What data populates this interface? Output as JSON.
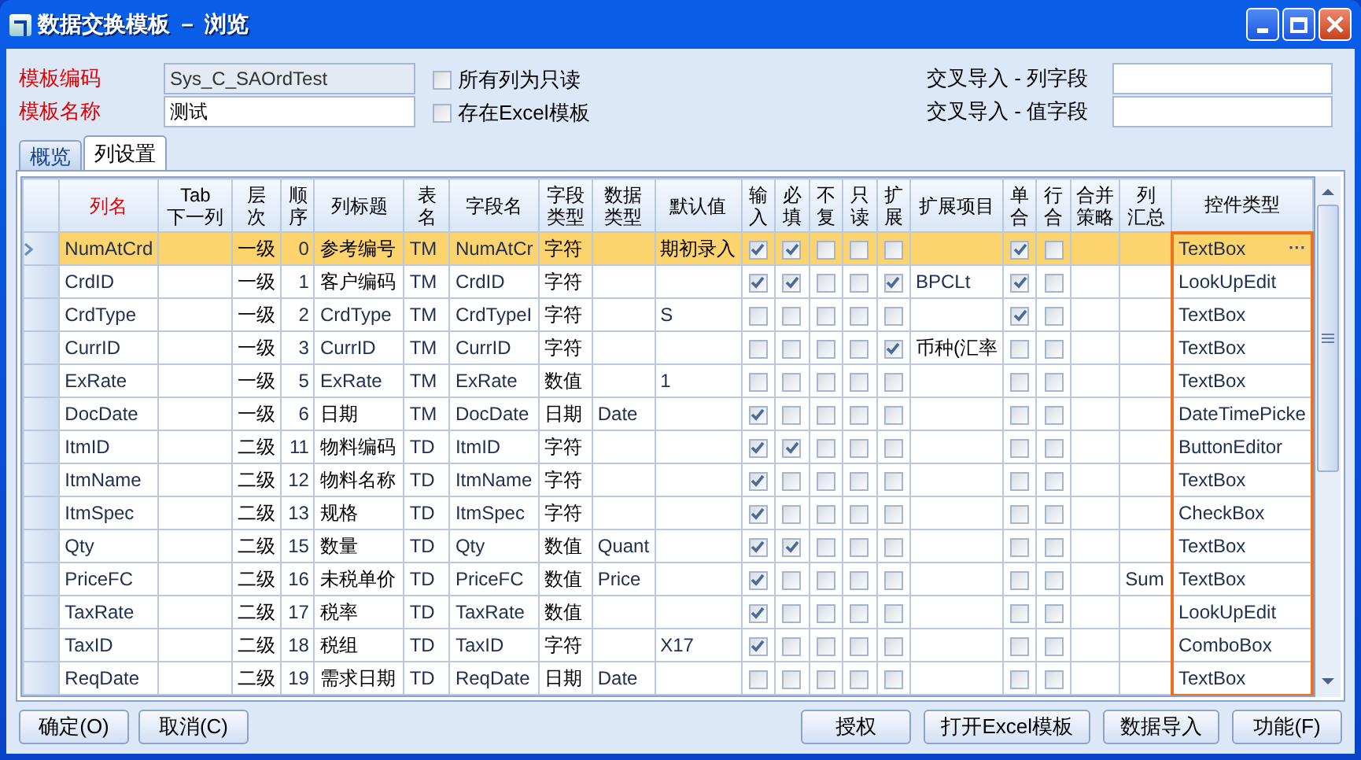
{
  "window": {
    "title": "数据交换模板 － 浏览"
  },
  "form": {
    "fields": [
      {
        "label": "模板编码",
        "value": "Sys_C_SAOrdTest",
        "disabled": true
      },
      {
        "label": "模板名称",
        "value": "测试",
        "disabled": false
      }
    ],
    "checkboxes": [
      {
        "label": "所有列为只读",
        "checked": false
      },
      {
        "label": "存在Excel模板",
        "checked": false
      }
    ],
    "cross_fields": [
      {
        "label": "交叉导入 - 列字段"
      },
      {
        "label": "交叉导入 - 值字段"
      }
    ]
  },
  "tabs": [
    {
      "label": "概览",
      "selected": false
    },
    {
      "label": "列设置",
      "selected": true
    }
  ],
  "table": {
    "columns": [
      {
        "lines": [
          "列名"
        ],
        "kind": "text",
        "emphasis": true,
        "focused": false
      },
      {
        "lines": [
          "Tab",
          "下一列"
        ],
        "kind": "text",
        "emphasis": false,
        "focused": false
      },
      {
        "lines": [
          "层",
          "次"
        ],
        "kind": "text",
        "emphasis": false,
        "focused": false
      },
      {
        "lines": [
          "顺",
          "序"
        ],
        "kind": "number",
        "emphasis": false,
        "focused": false
      },
      {
        "lines": [
          "列标题"
        ],
        "kind": "text",
        "emphasis": false,
        "focused": false
      },
      {
        "lines": [
          "表",
          "名"
        ],
        "kind": "text",
        "emphasis": false,
        "focused": false
      },
      {
        "lines": [
          "字段名"
        ],
        "kind": "text",
        "emphasis": false,
        "focused": false
      },
      {
        "lines": [
          "字段",
          "类型"
        ],
        "kind": "text",
        "emphasis": false,
        "focused": false
      },
      {
        "lines": [
          "数据",
          "类型"
        ],
        "kind": "text",
        "emphasis": false,
        "focused": false
      },
      {
        "lines": [
          "默认值"
        ],
        "kind": "text",
        "emphasis": false,
        "focused": false
      },
      {
        "lines": [
          "输",
          "入"
        ],
        "kind": "check",
        "emphasis": false,
        "focused": false
      },
      {
        "lines": [
          "必",
          "填"
        ],
        "kind": "check",
        "emphasis": false,
        "focused": false
      },
      {
        "lines": [
          "不",
          "复"
        ],
        "kind": "check",
        "emphasis": false,
        "focused": false
      },
      {
        "lines": [
          "只",
          "读"
        ],
        "kind": "check",
        "emphasis": false,
        "focused": false
      },
      {
        "lines": [
          "扩",
          "展"
        ],
        "kind": "check",
        "emphasis": false,
        "focused": false
      },
      {
        "lines": [
          "扩展项目"
        ],
        "kind": "text",
        "emphasis": false,
        "focused": false
      },
      {
        "lines": [
          "单",
          "合"
        ],
        "kind": "check",
        "emphasis": false,
        "focused": false
      },
      {
        "lines": [
          "行",
          "合"
        ],
        "kind": "check",
        "emphasis": false,
        "focused": false
      },
      {
        "lines": [
          "合并",
          "策略"
        ],
        "kind": "text",
        "emphasis": false,
        "focused": false
      },
      {
        "lines": [
          "列",
          "汇总"
        ],
        "kind": "text",
        "emphasis": false,
        "focused": false
      },
      {
        "lines": [
          "控件类型"
        ],
        "kind": "text",
        "emphasis": false,
        "focused": true
      }
    ],
    "rows": [
      {
        "selected": true,
        "cells": [
          "NumAtCrd",
          null,
          "一级",
          "0",
          "参考编号",
          "TM",
          "NumAtCr",
          "字符",
          null,
          "期初录入",
          true,
          true,
          false,
          false,
          false,
          null,
          true,
          false,
          null,
          null,
          "TextBox"
        ],
        "button": "···"
      },
      {
        "selected": false,
        "cells": [
          "CrdID",
          null,
          "一级",
          "1",
          "客户编码",
          "TM",
          "CrdID",
          "字符",
          null,
          null,
          true,
          true,
          false,
          false,
          true,
          "BPCLt",
          true,
          false,
          null,
          null,
          "LookUpEdit"
        ]
      },
      {
        "selected": false,
        "cells": [
          "CrdType",
          null,
          "一级",
          "2",
          "CrdType",
          "TM",
          "CrdTypeI",
          "字符",
          null,
          "S",
          false,
          false,
          false,
          false,
          false,
          null,
          true,
          false,
          null,
          null,
          "TextBox"
        ]
      },
      {
        "selected": false,
        "cells": [
          "CurrID",
          null,
          "一级",
          "3",
          "CurrID",
          "TM",
          "CurrID",
          "字符",
          null,
          null,
          false,
          false,
          false,
          false,
          true,
          "币种(汇率",
          false,
          false,
          null,
          null,
          "TextBox"
        ]
      },
      {
        "selected": false,
        "cells": [
          "ExRate",
          null,
          "一级",
          "5",
          "ExRate",
          "TM",
          "ExRate",
          "数值",
          null,
          "1",
          false,
          false,
          false,
          false,
          false,
          null,
          false,
          false,
          null,
          null,
          "TextBox"
        ]
      },
      {
        "selected": false,
        "cells": [
          "DocDate",
          null,
          "一级",
          "6",
          "日期",
          "TM",
          "DocDate",
          "日期",
          "Date",
          null,
          true,
          false,
          false,
          false,
          false,
          null,
          false,
          false,
          null,
          null,
          "DateTimePicke"
        ]
      },
      {
        "selected": false,
        "cells": [
          "ItmID",
          null,
          "二级",
          "11",
          "物料编码",
          "TD",
          "ItmID",
          "字符",
          null,
          null,
          true,
          true,
          false,
          false,
          false,
          null,
          false,
          false,
          null,
          null,
          "ButtonEditor"
        ]
      },
      {
        "selected": false,
        "cells": [
          "ItmName",
          null,
          "二级",
          "12",
          "物料名称",
          "TD",
          "ItmName",
          "字符",
          null,
          null,
          true,
          false,
          false,
          false,
          false,
          null,
          false,
          false,
          null,
          null,
          "TextBox"
        ]
      },
      {
        "selected": false,
        "cells": [
          "ItmSpec",
          null,
          "二级",
          "13",
          "规格",
          "TD",
          "ItmSpec",
          "字符",
          null,
          null,
          true,
          false,
          false,
          false,
          false,
          null,
          false,
          false,
          null,
          null,
          "CheckBox"
        ]
      },
      {
        "selected": false,
        "cells": [
          "Qty",
          null,
          "二级",
          "15",
          "数量",
          "TD",
          "Qty",
          "数值",
          "Quant",
          null,
          true,
          true,
          false,
          false,
          false,
          null,
          false,
          false,
          null,
          null,
          "TextBox"
        ]
      },
      {
        "selected": false,
        "cells": [
          "PriceFC",
          null,
          "二级",
          "16",
          "未税单价",
          "TD",
          "PriceFC",
          "数值",
          "Price",
          null,
          true,
          false,
          false,
          false,
          false,
          null,
          false,
          false,
          null,
          "Sum",
          "TextBox"
        ]
      },
      {
        "selected": false,
        "cells": [
          "TaxRate",
          null,
          "二级",
          "17",
          "税率",
          "TD",
          "TaxRate",
          "数值",
          null,
          null,
          true,
          false,
          false,
          false,
          false,
          null,
          false,
          false,
          null,
          null,
          "LookUpEdit"
        ]
      },
      {
        "selected": false,
        "cells": [
          "TaxID",
          null,
          "二级",
          "18",
          "税组",
          "TD",
          "TaxID",
          "字符",
          null,
          "X17",
          true,
          false,
          false,
          false,
          false,
          null,
          false,
          false,
          null,
          null,
          "ComboBox"
        ]
      },
      {
        "selected": false,
        "cells": [
          "ReqDate",
          null,
          "二级",
          "19",
          "需求日期",
          "TD",
          "ReqDate",
          "日期",
          "Date",
          null,
          false,
          false,
          false,
          false,
          false,
          null,
          false,
          false,
          null,
          null,
          "TextBox"
        ]
      }
    ]
  },
  "buttons_left": [
    "确定(O)",
    "取消(C)"
  ],
  "buttons_right": [
    "授权",
    "打开Excel模板",
    "数据导入",
    "功能(F)"
  ]
}
